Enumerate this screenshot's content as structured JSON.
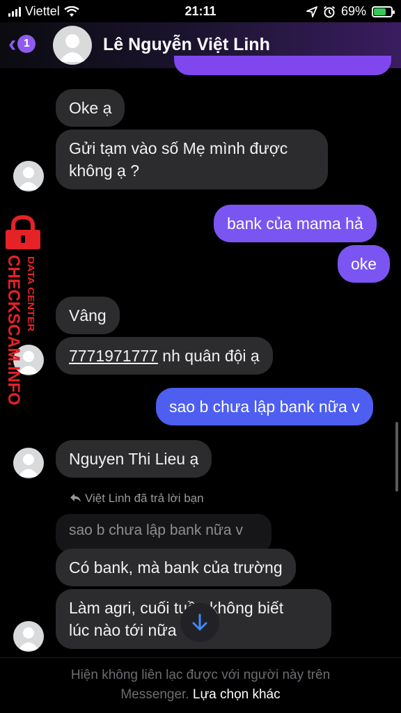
{
  "status_bar": {
    "carrier": "Viettel",
    "time": "21:11",
    "battery": "69%"
  },
  "header": {
    "back_badge": "1",
    "contact_name": "Lê Nguyễn Việt Linh"
  },
  "messages": {
    "m1": "Oke ạ",
    "m2_line1": "Gửi tạm vào số Mẹ mình được",
    "m2_line2": "không ạ ?",
    "m3": "bank của mama hả",
    "m4": "oke",
    "m5": "Vâng",
    "m6_number": "7771971777",
    "m6_rest": " nh quân đội ạ",
    "m7": "sao b chưa lập bank nữa v",
    "m8": "Nguyen Thi Lieu ạ",
    "reply_note": "Việt Linh đã trả lời bạn",
    "quoted": "sao b chưa lập bank nữa v",
    "m9": "Có bank, mà bank của trường",
    "m10_line1": "Làm agri, cuối tuần không biết",
    "m10_line2": "lúc nào tới nữa"
  },
  "footer": {
    "text_line1": "Hiện không liên lạc được với người này trên",
    "text_line2_a": "Messenger.",
    "link": "Lựa chọn khác"
  },
  "watermark": {
    "small": "DATA CENTER",
    "large": "CHECKSCAM.INFO",
    "color": "#e52226"
  },
  "colors": {
    "outgoing_purple": "#7a55f2",
    "outgoing_blue": "#4d5ef0",
    "incoming": "#2c2c2e",
    "accent": "#8e5bf0"
  },
  "icons": [
    "signal-icon",
    "wifi-icon",
    "location-icon",
    "alarm-icon",
    "battery-icon",
    "back-chevron-icon",
    "scroll-down-arrow-icon",
    "reply-icon",
    "lock-icon"
  ]
}
